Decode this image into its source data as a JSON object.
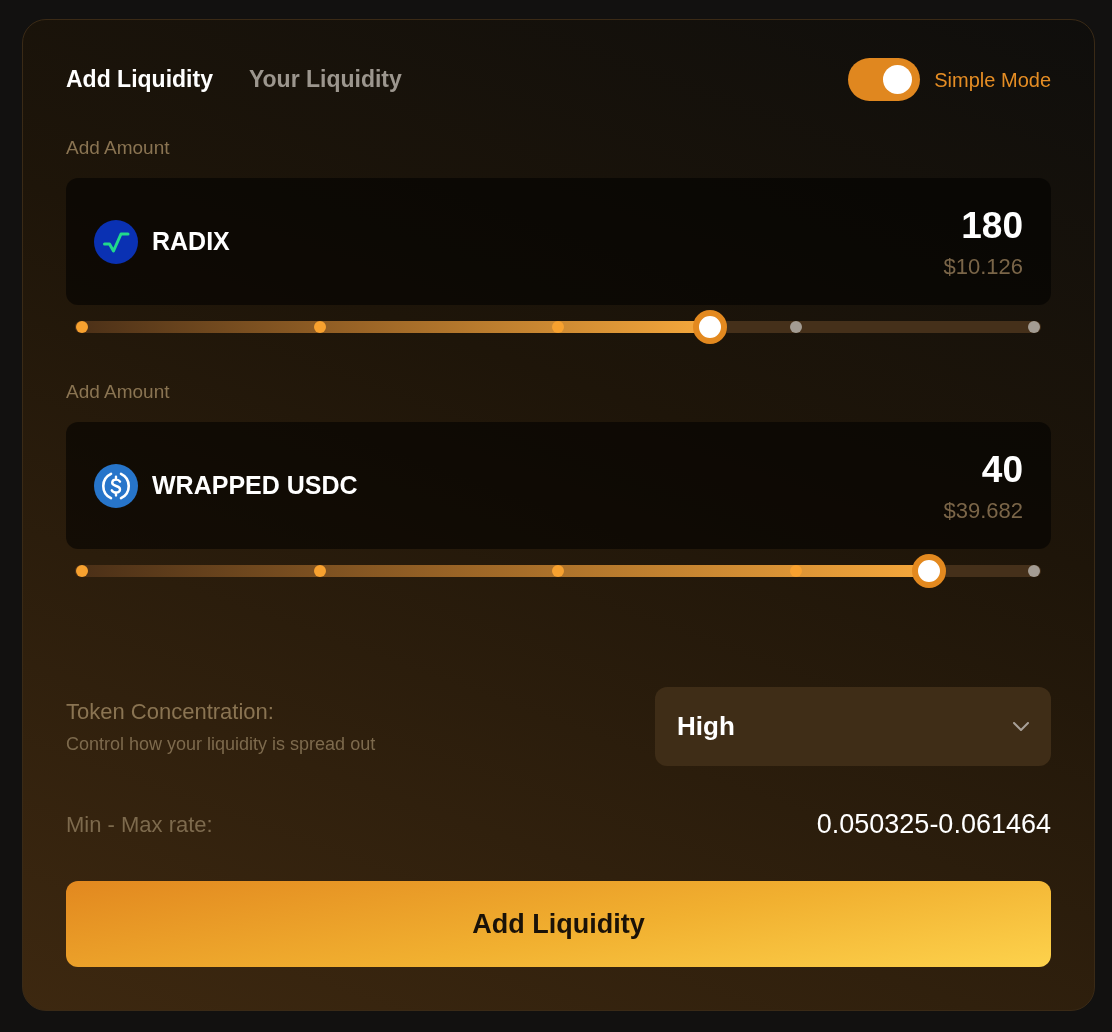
{
  "tabs": [
    {
      "label": "Add Liquidity",
      "selected": true
    },
    {
      "label": "Your Liquidity",
      "selected": false
    }
  ],
  "mode_toggle": {
    "label": "Simple Mode",
    "on": true
  },
  "amounts": [
    {
      "label": "Add Amount",
      "kind": "root",
      "token": "RADIX",
      "amount": "180",
      "usd_value": "$10.126",
      "level": 0.66
    },
    {
      "label": "Add Amount",
      "kind": "dollar",
      "token": "WRAPPED USDC",
      "amount": "40",
      "usd_value": "$39.682",
      "level": 0.89
    }
  ],
  "concentration": {
    "label": "Token Concentration:",
    "hint": "Control how your liquidity is spread out",
    "value": "High"
  },
  "rate": {
    "label": "Min - Max rate:",
    "value": "0.050325-0.061464"
  },
  "submit_button": {
    "label": "Add Liquidity"
  }
}
